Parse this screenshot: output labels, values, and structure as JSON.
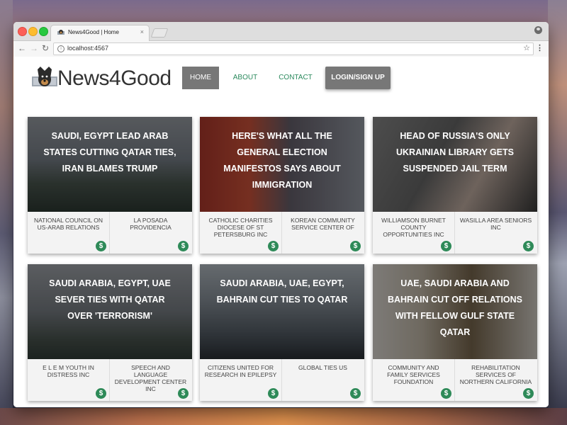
{
  "browser": {
    "tab_title": "News4Good | Home",
    "tab_close": "×",
    "url": "localhost:4567",
    "back": "←",
    "forward": "→",
    "reload": "↻",
    "star": "☆",
    "menu": "⋮",
    "info": "i"
  },
  "site": {
    "logo_text": "News4Good",
    "nav": {
      "home": "HOME",
      "about": "ABOUT",
      "contact": "CONTACT",
      "login": "LOGIN/SIGN UP"
    }
  },
  "cards": [
    {
      "title": "Saudi, Egypt lead Arab states cutting Qatar ties, Iran blames Trump",
      "org_left": "National Council on US-Arab Relations",
      "org_right": "La Posada Providencia"
    },
    {
      "title": "Here's what all the general election manifestos says about immigration",
      "org_left": "Catholic Charities Diocese of St Petersburg Inc",
      "org_right": "Korean Community Service Center of"
    },
    {
      "title": "Head of Russia's only Ukrainian library gets suspended jail term",
      "org_left": "Williamson Burnet County Opportunities Inc",
      "org_right": "Wasilla Area Seniors Inc"
    },
    {
      "title": "Saudi Arabia, Egypt, UAE sever ties with Qatar over 'terrorism'",
      "org_left": "E L E M Youth in Distress Inc",
      "org_right": "Speech and Language Development Center Inc"
    },
    {
      "title": "Saudi Arabia, UAE, Egypt, Bahrain cut ties to Qatar",
      "org_left": "Citizens United for Research in Epilepsy",
      "org_right": "Global Ties US"
    },
    {
      "title": "UAE, Saudi Arabia and Bahrain cut off relations with fellow Gulf state Qatar",
      "org_left": "Community and Family Services Foundation",
      "org_right": "Rehabilitation Services of Northern California"
    }
  ],
  "donate_symbol": "$"
}
